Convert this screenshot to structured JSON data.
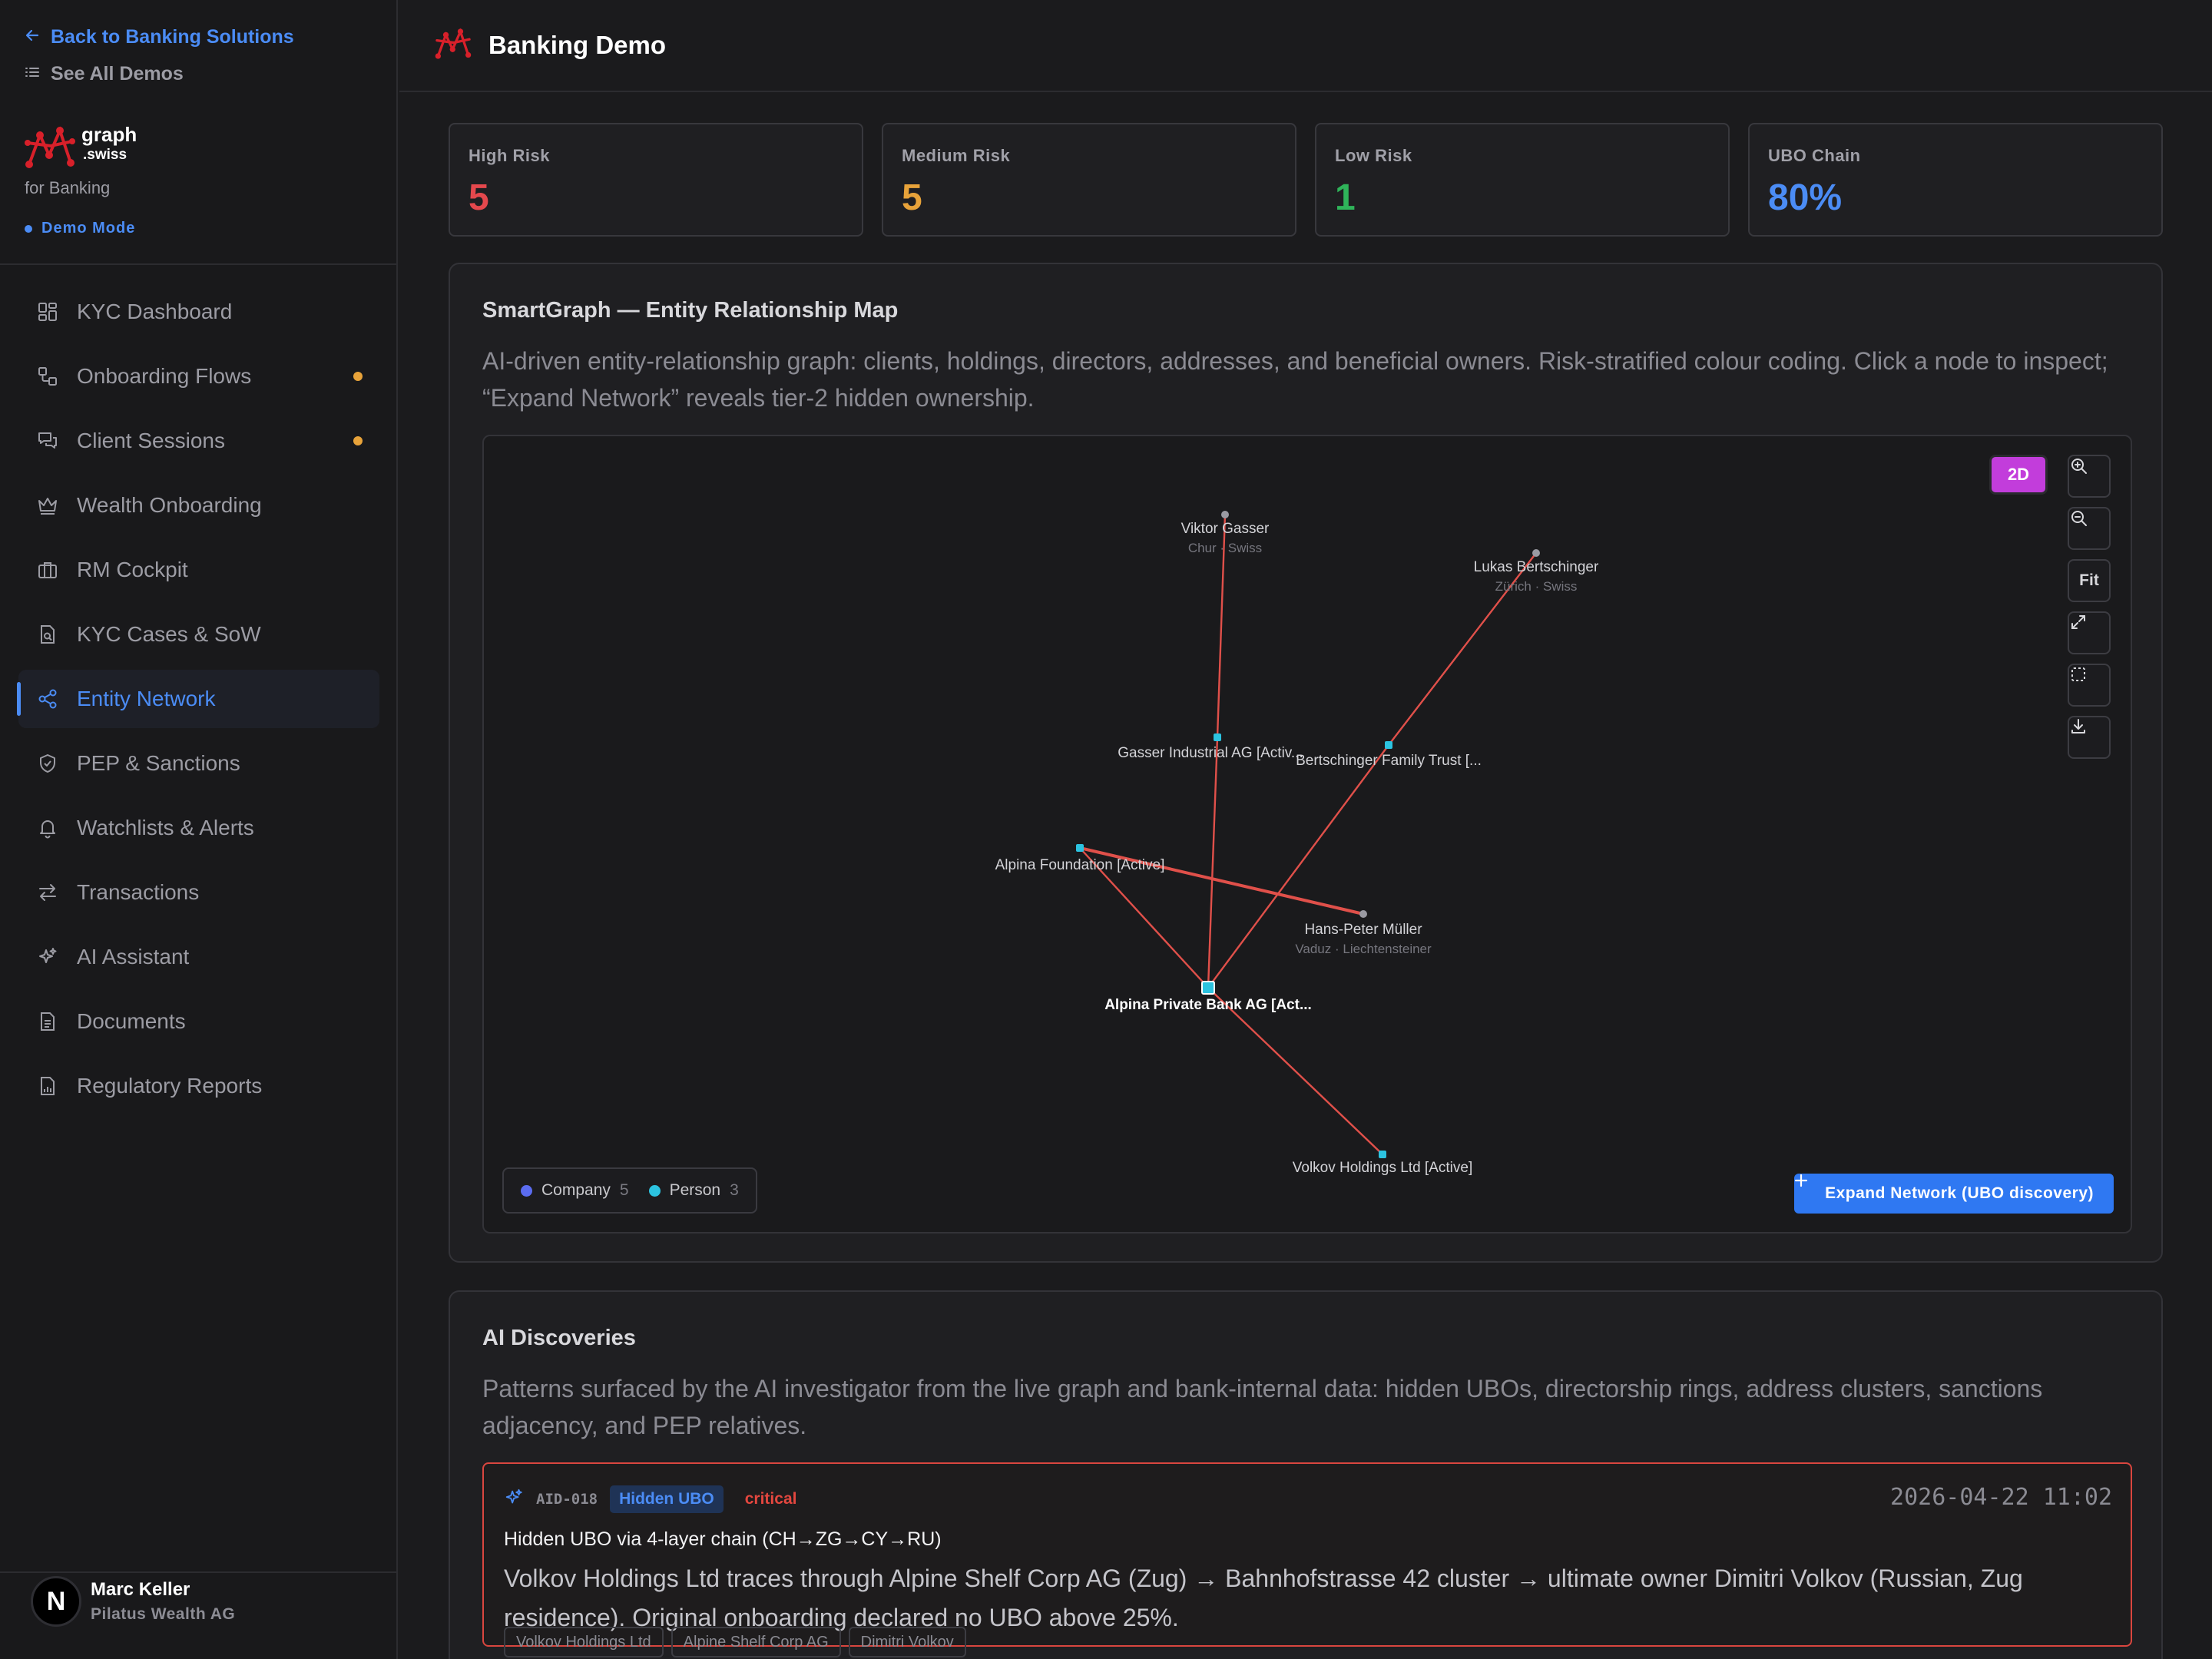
{
  "sidebar": {
    "back_label": "Back to Banking Solutions",
    "see_all_label": "See All Demos",
    "brand_line1": "graph",
    "brand_line2": ".swiss",
    "brand_tagline": "for Banking",
    "demo_mode": "Demo Mode",
    "items": [
      {
        "label": "KYC Dashboard",
        "icon": "dashboard-icon"
      },
      {
        "label": "Onboarding Flows",
        "icon": "flow-icon",
        "badge": true
      },
      {
        "label": "Client Sessions",
        "icon": "chat-icon",
        "badge": true
      },
      {
        "label": "Wealth Onboarding",
        "icon": "crown-icon"
      },
      {
        "label": "RM Cockpit",
        "icon": "briefcase-icon"
      },
      {
        "label": "KYC Cases & SoW",
        "icon": "file-search-icon"
      },
      {
        "label": "Entity Network",
        "icon": "share-icon",
        "active": true
      },
      {
        "label": "PEP & Sanctions",
        "icon": "shield-icon"
      },
      {
        "label": "Watchlists & Alerts",
        "icon": "bell-icon"
      },
      {
        "label": "Transactions",
        "icon": "transfer-icon"
      },
      {
        "label": "AI Assistant",
        "icon": "sparkle-icon"
      },
      {
        "label": "Documents",
        "icon": "document-icon"
      },
      {
        "label": "Regulatory Reports",
        "icon": "report-icon"
      }
    ],
    "user": {
      "initial": "N",
      "name": "Marc Keller",
      "org": "Pilatus Wealth AG"
    }
  },
  "header": {
    "title": "Banking Demo"
  },
  "stats": [
    {
      "label": "High Risk",
      "value": "5",
      "color": "#e5484d"
    },
    {
      "label": "Medium Risk",
      "value": "5",
      "color": "#e8a33a"
    },
    {
      "label": "Low Risk",
      "value": "1",
      "color": "#2fb45a"
    },
    {
      "label": "UBO Chain",
      "value": "80%",
      "color": "#4b8cf5"
    }
  ],
  "smartgraph": {
    "title": "SmartGraph — Entity Relationship Map",
    "description": "AI-driven entity-relationship graph: clients, holdings, directors, addresses, and beneficial owners. Risk-stratified colour coding. Click a node to inspect; “Expand Network” reveals tier-2 hidden ownership.",
    "mode_label": "2D",
    "fit_label": "Fit",
    "expand_label": "Expand Network (UBO discovery)",
    "legend": [
      {
        "label": "Company",
        "count": "5",
        "color": "#5b6cf0"
      },
      {
        "label": "Person",
        "count": "3",
        "color": "#2cc3e0"
      }
    ],
    "nodes": [
      {
        "id": "viktor",
        "label": "Viktor Gasser",
        "sub": "Chur · Swiss"
      },
      {
        "id": "lukas",
        "label": "Lukas Bertschinger",
        "sub": "Zürich · Swiss"
      },
      {
        "id": "gasser_ind",
        "label": "Gasser Industrial AG [Activ..."
      },
      {
        "id": "bert_trust",
        "label": "Bertschinger Family Trust [..."
      },
      {
        "id": "alpina_found",
        "label": "Alpina Foundation [Active]"
      },
      {
        "id": "hans",
        "label": "Hans-Peter Müller",
        "sub": "Vaduz · Liechtensteiner"
      },
      {
        "id": "alpina_bank",
        "label": "Alpina Private Bank AG [Act..."
      },
      {
        "id": "volkov",
        "label": "Volkov Holdings Ltd [Active]"
      }
    ]
  },
  "discoveries": {
    "title": "AI Discoveries",
    "description": "Patterns surfaced by the AI investigator from the live graph and bank-internal data: hidden UBOs, directorship rings, address clusters, sanctions adjacency, and PEP relatives.",
    "card": {
      "id": "AID-018",
      "tag": "Hidden UBO",
      "severity": "critical",
      "timestamp": "2026-04-22 11:02",
      "title": "Hidden UBO via 4-layer chain (CH→ZG→CY→RU)",
      "body": "Volkov Holdings Ltd traces through Alpine Shelf Corp AG (Zug) → Bahnhofstrasse 42 cluster → ultimate owner Dimitri Volkov (Russian, Zug residence). Original onboarding declared no UBO above 25%.",
      "chips": [
        "Volkov Holdings Ltd",
        "Alpine Shelf Corp AG",
        "Dimitri Volkov"
      ]
    }
  }
}
